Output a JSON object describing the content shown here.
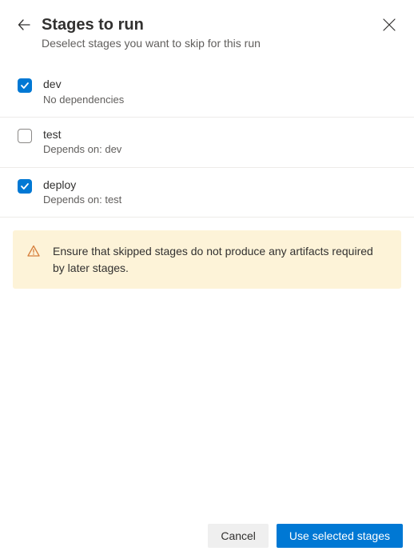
{
  "header": {
    "title": "Stages to run",
    "subtitle": "Deselect stages you want to skip for this run"
  },
  "stages": [
    {
      "name": "dev",
      "dependency": "No dependencies",
      "checked": true
    },
    {
      "name": "test",
      "dependency": "Depends on: dev",
      "checked": false
    },
    {
      "name": "deploy",
      "dependency": "Depends on: test",
      "checked": true
    }
  ],
  "warning": {
    "text": "Ensure that skipped stages do not produce any artifacts required by later stages."
  },
  "footer": {
    "cancel_label": "Cancel",
    "primary_label": "Use selected stages"
  },
  "colors": {
    "primary": "#0078d4",
    "warning_bg": "#fdf3d8",
    "warning_icon": "#d67f3c"
  }
}
